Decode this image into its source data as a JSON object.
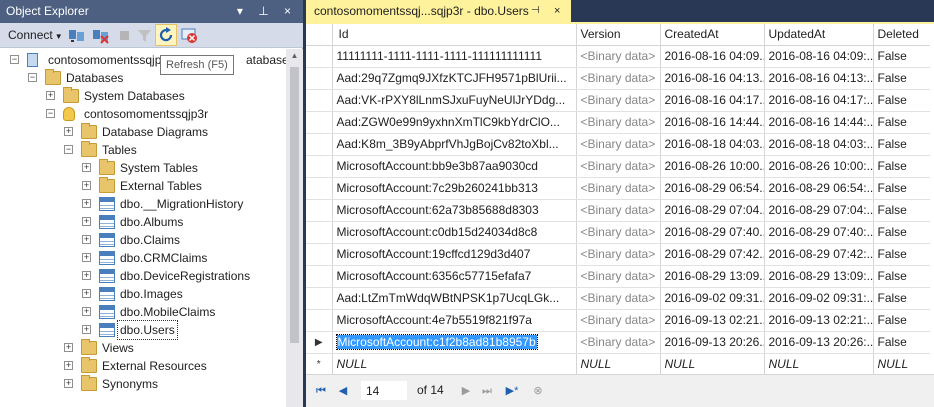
{
  "object_explorer": {
    "title": "Object Explorer",
    "title_buttons": "▾ ⊥ ×",
    "connect_label": "Connect",
    "tooltip": "Refresh (F5)",
    "tree": [
      {
        "label": "contosomomentssqjp",
        "label_tail": "atabase.w",
        "icon": "server-icon",
        "exp": "−",
        "level": 0
      },
      {
        "label": "Databases",
        "icon": "folder-icon",
        "exp": "−",
        "level": 1
      },
      {
        "label": "System Databases",
        "icon": "folder-icon",
        "exp": "+",
        "level": 2
      },
      {
        "label": "contosomomentssqjp3r",
        "icon": "database-icon",
        "exp": "−",
        "level": 2
      },
      {
        "label": "Database Diagrams",
        "icon": "folder-icon",
        "exp": "+",
        "level": 3
      },
      {
        "label": "Tables",
        "icon": "folder-icon",
        "exp": "−",
        "level": 3
      },
      {
        "label": "System Tables",
        "icon": "folder-icon",
        "exp": "+",
        "level": 4
      },
      {
        "label": "External Tables",
        "icon": "folder-icon",
        "exp": "+",
        "level": 4
      },
      {
        "label": "dbo.__MigrationHistory",
        "icon": "table-icon",
        "exp": "+",
        "level": 4
      },
      {
        "label": "dbo.Albums",
        "icon": "table-icon",
        "exp": "+",
        "level": 4
      },
      {
        "label": "dbo.Claims",
        "icon": "table-icon",
        "exp": "+",
        "level": 4
      },
      {
        "label": "dbo.CRMClaims",
        "icon": "table-icon",
        "exp": "+",
        "level": 4
      },
      {
        "label": "dbo.DeviceRegistrations",
        "icon": "table-icon",
        "exp": "+",
        "level": 4
      },
      {
        "label": "dbo.Images",
        "icon": "table-icon",
        "exp": "+",
        "level": 4
      },
      {
        "label": "dbo.MobileClaims",
        "icon": "table-icon",
        "exp": "+",
        "level": 4
      },
      {
        "label": "dbo.Users",
        "icon": "table-icon",
        "exp": "+",
        "level": 4,
        "selected": true
      },
      {
        "label": "Views",
        "icon": "folder-icon",
        "exp": "+",
        "level": 3
      },
      {
        "label": "External Resources",
        "icon": "folder-icon",
        "exp": "+",
        "level": 3
      },
      {
        "label": "Synonyms",
        "icon": "folder-icon",
        "exp": "+",
        "level": 3
      }
    ]
  },
  "document": {
    "tab_title": "contosomomentssqj...sqjp3r - dbo.Users",
    "pin_glyph": "⊣",
    "close_glyph": "×",
    "columns": [
      "Id",
      "Version",
      "CreatedAt",
      "UpdatedAt",
      "Deleted"
    ],
    "rows": [
      [
        "11111111-1111-1111-1111-111111111111",
        "<Binary data>",
        "2016-08-16 04:09...",
        "2016-08-16 04:09:...",
        "False"
      ],
      [
        "Aad:29q7Zgmq9JXfzKTCJFH9571pBlUrii...",
        "<Binary data>",
        "2016-08-16 04:13...",
        "2016-08-16 04:13:...",
        "False"
      ],
      [
        "Aad:VK-rPXY8lLnmSJxuFuyNeUlJrYDdg...",
        "<Binary data>",
        "2016-08-16 04:17...",
        "2016-08-16 04:17:...",
        "False"
      ],
      [
        "Aad:ZGW0e99n9yxhnXmTlC9kbYdrClO...",
        "<Binary data>",
        "2016-08-16 14:44...",
        "2016-08-16 14:44:...",
        "False"
      ],
      [
        "Aad:K8m_3B9yAbprfVhJgBojCv82toXbl...",
        "<Binary data>",
        "2016-08-18 04:03...",
        "2016-08-18 04:03:...",
        "False"
      ],
      [
        "MicrosoftAccount:bb9e3b87aa9030cd",
        "<Binary data>",
        "2016-08-26 10:00...",
        "2016-08-26 10:00:...",
        "False"
      ],
      [
        "MicrosoftAccount:7c29b260241bb313",
        "<Binary data>",
        "2016-08-29 06:54...",
        "2016-08-29 06:54:...",
        "False"
      ],
      [
        "MicrosoftAccount:62a73b85688d8303",
        "<Binary data>",
        "2016-08-29 07:04...",
        "2016-08-29 07:04:...",
        "False"
      ],
      [
        "MicrosoftAccount:c0db15d24034d8c8",
        "<Binary data>",
        "2016-08-29 07:40...",
        "2016-08-29 07:40:...",
        "False"
      ],
      [
        "MicrosoftAccount:19cffcd129d3d407",
        "<Binary data>",
        "2016-08-29 07:42...",
        "2016-08-29 07:42:...",
        "False"
      ],
      [
        "MicrosoftAccount:6356c57715efafa7",
        "<Binary data>",
        "2016-08-29 13:09...",
        "2016-08-29 13:09:...",
        "False"
      ],
      [
        "Aad:LtZmTmWdqWBtNPSK1p7UcqLGk...",
        "<Binary data>",
        "2016-09-02 09:31...",
        "2016-09-02 09:31:...",
        "False"
      ],
      [
        "MicrosoftAccount:4e7b5519f821f97a",
        "<Binary data>",
        "2016-09-13 02:21...",
        "2016-09-13 02:21:...",
        "False"
      ],
      [
        "MicrosoftAccount:c1f2b8ad81b8957b",
        "<Binary data>",
        "2016-09-13 20:26...",
        "2016-09-13 20:26:...",
        "False"
      ],
      [
        "NULL",
        "NULL",
        "NULL",
        "NULL",
        "NULL"
      ]
    ],
    "current_row_glyph": "▶",
    "new_row_glyph": "*",
    "nav": {
      "first_glyph": "⏮",
      "prev_glyph": "◀",
      "page_value": "14",
      "of_label": "of 14",
      "next_glyph": "▶",
      "last_glyph": "⏭",
      "new_glyph": "▶*",
      "stop_glyph": "⊗"
    }
  }
}
